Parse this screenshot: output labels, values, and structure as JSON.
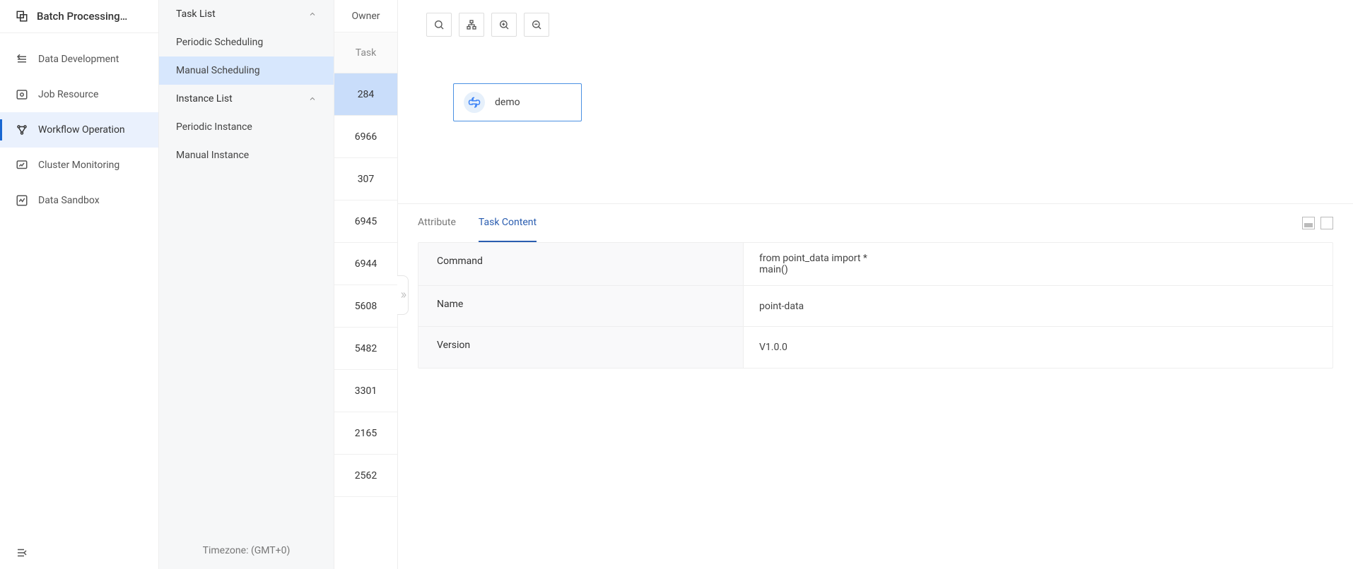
{
  "brand": {
    "title": "Batch Processing…"
  },
  "sidebar": {
    "items": [
      {
        "label": "Data Development",
        "icon": "data-dev-icon",
        "active": false
      },
      {
        "label": "Job Resource",
        "icon": "job-resource-icon",
        "active": false
      },
      {
        "label": "Workflow Operation",
        "icon": "workflow-icon",
        "active": true
      },
      {
        "label": "Cluster Monitoring",
        "icon": "cluster-icon",
        "active": false
      },
      {
        "label": "Data Sandbox",
        "icon": "sandbox-icon",
        "active": false
      }
    ]
  },
  "subnav": {
    "groups": [
      {
        "label": "Task List",
        "expanded": true,
        "items": [
          {
            "label": "Periodic Scheduling",
            "active": false
          },
          {
            "label": "Manual Scheduling",
            "active": true
          }
        ]
      },
      {
        "label": "Instance List",
        "expanded": true,
        "items": [
          {
            "label": "Periodic Instance",
            "active": false
          },
          {
            "label": "Manual Instance",
            "active": false
          }
        ]
      }
    ],
    "timezone": "Timezone: (GMT+0)"
  },
  "listCol": {
    "header": "Owner",
    "subheader": "Task",
    "rows": [
      "284",
      "6966",
      "307",
      "6945",
      "6944",
      "5608",
      "5482",
      "3301",
      "2165",
      "2562"
    ],
    "selectedIndex": 0
  },
  "canvas": {
    "node": {
      "label": "demo",
      "type": "python"
    }
  },
  "details": {
    "tabs": [
      {
        "label": "Attribute",
        "active": false
      },
      {
        "label": "Task Content",
        "active": true
      }
    ],
    "content": {
      "rows": [
        {
          "key": "Command",
          "value": "from point_data import *\nmain()"
        },
        {
          "key": "Name",
          "value": "point-data"
        },
        {
          "key": "Version",
          "value": "V1.0.0"
        }
      ]
    }
  }
}
